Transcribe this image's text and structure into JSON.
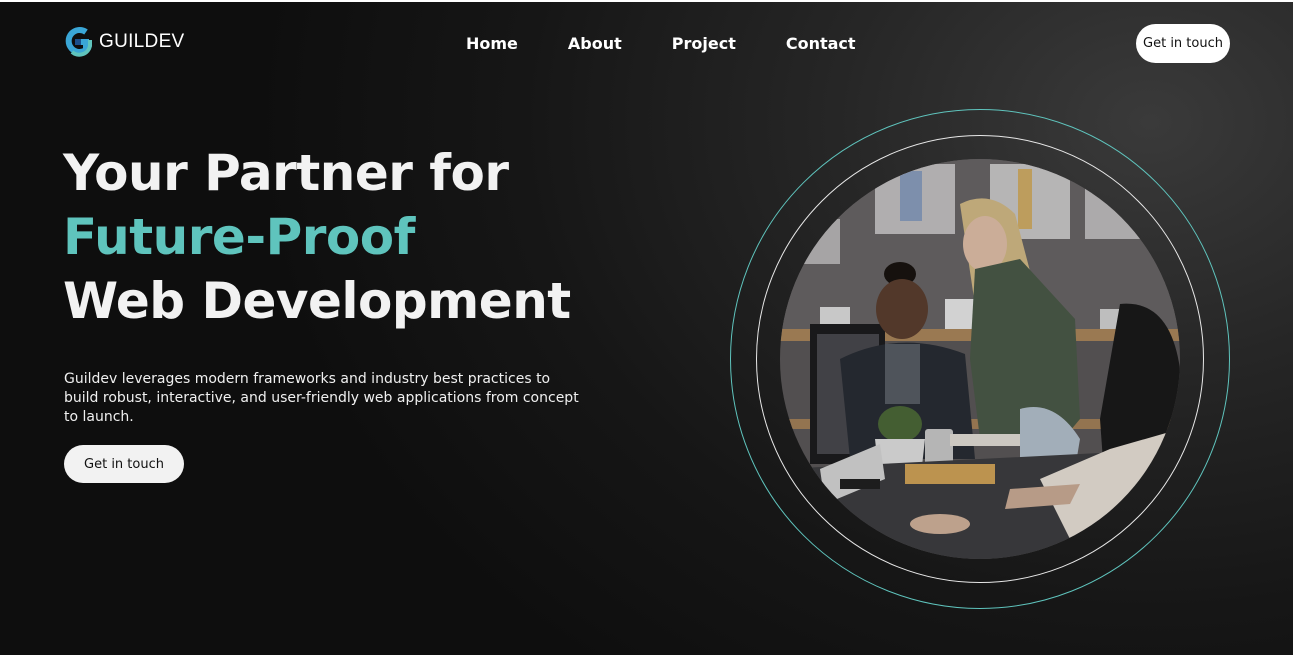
{
  "brand": {
    "name": "GUILDEV",
    "logo_icon": "guildev-logo-icon",
    "accent_color": "#5fc4bd",
    "logo_colors": [
      "#3aa6d6",
      "#5fc4bd",
      "#1b4f8c"
    ]
  },
  "nav": {
    "items": [
      {
        "label": "Home"
      },
      {
        "label": "About"
      },
      {
        "label": "Project"
      },
      {
        "label": "Contact"
      }
    ],
    "cta_label": "Get in touch"
  },
  "hero": {
    "title_line1": "Your Partner for",
    "title_accent": "Future-Proof",
    "title_line3": "Web Development",
    "description": "Guildev leverages modern frameworks and industry best practices to build robust, interactive, and user-friendly web applications from concept to launch.",
    "cta_label": "Get in touch",
    "background_color": "#111111",
    "title_color": "#f2f2f2"
  },
  "image": {
    "subject": "team-working-at-desks-photo",
    "outer_ring_color": "#5fc4bd",
    "inner_ring_color": "#e8e8e8"
  }
}
